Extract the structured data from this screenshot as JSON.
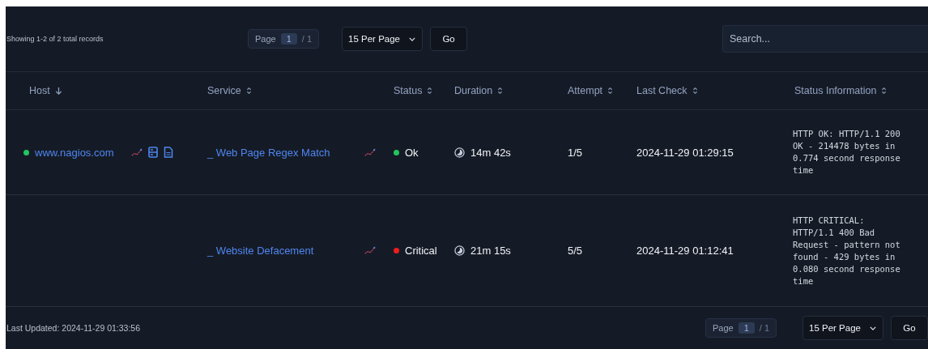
{
  "toolbar": {
    "summary": "Showing 1-2 of 2 total records",
    "pager": {
      "label": "Page",
      "current": "1",
      "total": "/ 1"
    },
    "per_page": "15 Per Page",
    "go": "Go",
    "search": {
      "placeholder": "Search..."
    }
  },
  "table": {
    "columns": [
      {
        "label": "Host",
        "sorted": true
      },
      {
        "label": "Service",
        "sorted": false
      },
      {
        "label": "Status",
        "sorted": false
      },
      {
        "label": "Duration",
        "sorted": false
      },
      {
        "label": "Attempt",
        "sorted": false
      },
      {
        "label": "Last Check",
        "sorted": false
      },
      {
        "label": "Status Information",
        "sorted": false
      }
    ],
    "rows": [
      {
        "host": {
          "name": "www.nagios.com",
          "color": "#22c55e"
        },
        "service": "_ Web Page Regex Match",
        "status": {
          "label": "Ok",
          "color": "#22c55e"
        },
        "duration": "14m 42s",
        "attempt": "1/5",
        "last_check": "2024-11-29 01:29:15",
        "info": "HTTP OK: HTTP/1.1 200 OK - 214478 bytes in 0.774 second response time"
      },
      {
        "service": "_ Website Defacement",
        "status": {
          "label": "Critical",
          "color": "#ef1c1c"
        },
        "duration": "21m 15s",
        "attempt": "5/5",
        "last_check": "2024-11-29 01:12:41",
        "info": "HTTP CRITICAL: HTTP/1.1 400 Bad Request - pattern not found - 429 bytes in 0.080 second response time"
      }
    ]
  },
  "footer": {
    "updated": "Last Updated: 2024-11-29 01:33:56",
    "pager": {
      "label": "Page",
      "current": "1",
      "total": "/ 1"
    },
    "per_page": "15 Per Page",
    "go": "Go"
  }
}
